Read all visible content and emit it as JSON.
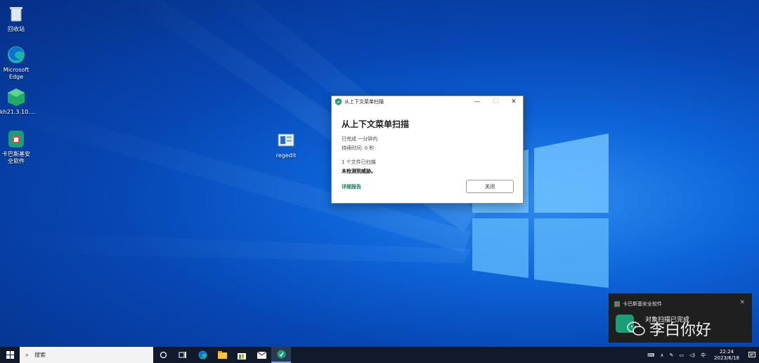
{
  "desktop": {
    "icons": [
      {
        "label": "回收站",
        "icon": "recycle-bin-icon"
      },
      {
        "label": "Microsoft Edge",
        "icon": "edge-icon"
      },
      {
        "label": "kh21.3.10....",
        "icon": "installer-icon"
      },
      {
        "label": "卡巴斯基安全软件",
        "icon": "kaspersky-icon"
      },
      {
        "label": "regedit",
        "icon": "regedit-icon"
      }
    ]
  },
  "dialog": {
    "window_title": "从上下文菜单扫描",
    "heading": "从上下文菜单扫描",
    "status_line": "已完成 一分钟内",
    "duration_line": "持续时间: 0 秒",
    "files_line": "1 个文件已扫描",
    "result_line": "未检测到威胁。",
    "report_link": "详细报告",
    "close_button": "关闭",
    "minimize_glyph": "—",
    "maximize_glyph": "☐",
    "close_glyph": "✕"
  },
  "toast": {
    "app_name": "卡巴斯基安全软件",
    "message": "对象扫描已完成",
    "close_glyph": "✕",
    "watermark": "李白你好"
  },
  "taskbar": {
    "search_placeholder": "搜索",
    "ime": "中",
    "time": "22:24",
    "date": "2023/6/18"
  },
  "colors": {
    "accent_green": "#0f7a5a",
    "kaspersky": "#1a9e79",
    "taskbar": "#101a2c"
  }
}
